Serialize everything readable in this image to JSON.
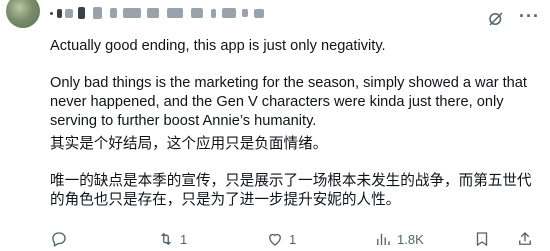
{
  "author": {
    "display_name_redacted": true,
    "handle_redacted": true
  },
  "colors": {
    "text_primary": "#0f1419",
    "text_secondary": "#536471",
    "avatar": "#7a8c6a"
  },
  "tweet": {
    "paragraphs": [
      "Actually good ending, this app is just only negativity.",
      "Only bad things is the marketing for the season, simply showed a war that never happened, and the Gen V characters were kinda just there, only serving to further boost Annie’s humanity.",
      "其实是个好结局，这个应用只是负面情绪。",
      "唯一的缺点是本季的宣传，只是展示了一场根本未发生的战争，而第五世代的角色也只是存在，只是为了进一步提升安妮的人性。"
    ]
  },
  "actions": {
    "reply_count": "",
    "retweet_count": "1",
    "like_count": "1",
    "views_count": "1.8K"
  },
  "icons": {
    "grok": "grok-icon",
    "more": "more-icon",
    "reply": "reply-icon",
    "retweet": "retweet-icon",
    "like": "heart-icon",
    "views": "views-icon",
    "bookmark": "bookmark-icon",
    "share": "share-icon"
  }
}
